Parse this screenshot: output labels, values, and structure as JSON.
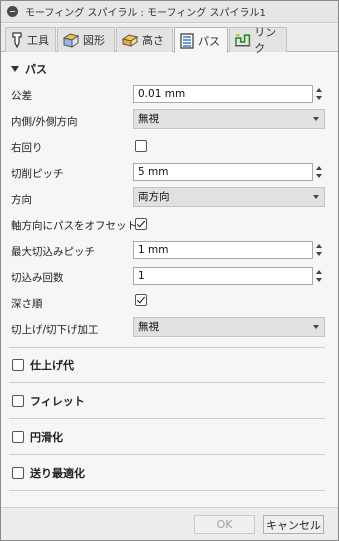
{
  "title": "モーフィング スパイラル : モーフィング スパイラル1",
  "tabs": [
    {
      "label": "工具",
      "icon": "tool-icon"
    },
    {
      "label": "図形",
      "icon": "geometry-icon"
    },
    {
      "label": "高さ",
      "icon": "heights-icon"
    },
    {
      "label": "パス",
      "icon": "passes-icon",
      "active": true
    },
    {
      "label": "リンク",
      "icon": "linking-icon"
    }
  ],
  "section": {
    "title": "パス",
    "expanded": true
  },
  "fields": {
    "tolerance": {
      "label": "公差",
      "value": "0.01 mm"
    },
    "direction_mode": {
      "label": "内側/外側方向",
      "value": "無視"
    },
    "clockwise": {
      "label": "右回り",
      "checked": false
    },
    "stepover": {
      "label": "切削ピッチ",
      "value": "5 mm"
    },
    "direction": {
      "label": "方向",
      "value": "両方向"
    },
    "offset_axial": {
      "label": "軸方向にパスをオフセット",
      "checked": true
    },
    "max_stepdown": {
      "label": "最大切込みピッチ",
      "value": "1 mm"
    },
    "num_stepdowns": {
      "label": "切込み回数",
      "value": "1"
    },
    "depth_order": {
      "label": "深さ順",
      "checked": true
    },
    "ramp_mode": {
      "label": "切上げ/切下げ加工",
      "value": "無視"
    }
  },
  "collapsed_sections": [
    {
      "label": "仕上げ代",
      "checked": false
    },
    {
      "label": "フィレット",
      "checked": false
    },
    {
      "label": "円滑化",
      "checked": false
    },
    {
      "label": "送り最適化",
      "checked": false
    }
  ],
  "footer": {
    "ok_label": "OK",
    "ok_enabled": false,
    "cancel_label": "キャンセル"
  }
}
